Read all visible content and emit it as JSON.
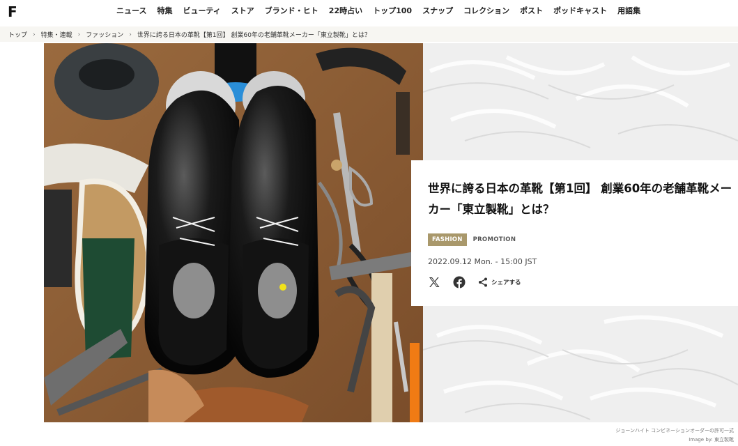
{
  "logo": "F",
  "nav": [
    "ニュース",
    "特集",
    "ビューティ",
    "ストア",
    "ブランド・ヒト",
    "22時占い",
    "トップ100",
    "スナップ",
    "コレクション",
    "ポスト",
    "ポッドキャスト",
    "用語集"
  ],
  "breadcrumb": [
    "トップ",
    "特集・連載",
    "ファッション",
    "世界に誇る日本の革靴【第1回】 創業60年の老舗革靴メーカー「東立製靴」とは？"
  ],
  "article": {
    "title": "世界に誇る日本の革靴【第1回】 創業60年の老舗革靴メーカー「東立製靴」とは？",
    "category_tag": "FASHION",
    "promotion_tag": "PROMOTION",
    "date": "2022.09.12 Mon. - 15:00 JST",
    "share_label": "シェアする"
  },
  "credits": {
    "caption": "ジョーンハイト コンビネーションオーダーの許可一式",
    "image_by": "Image by: 東立製靴"
  },
  "colors": {
    "tag_bg": "#a9986b",
    "breadcrumb_bg": "#f7f6f2"
  },
  "icons": [
    "x-icon",
    "facebook-icon",
    "share-icon",
    "chevron-right-icon"
  ]
}
